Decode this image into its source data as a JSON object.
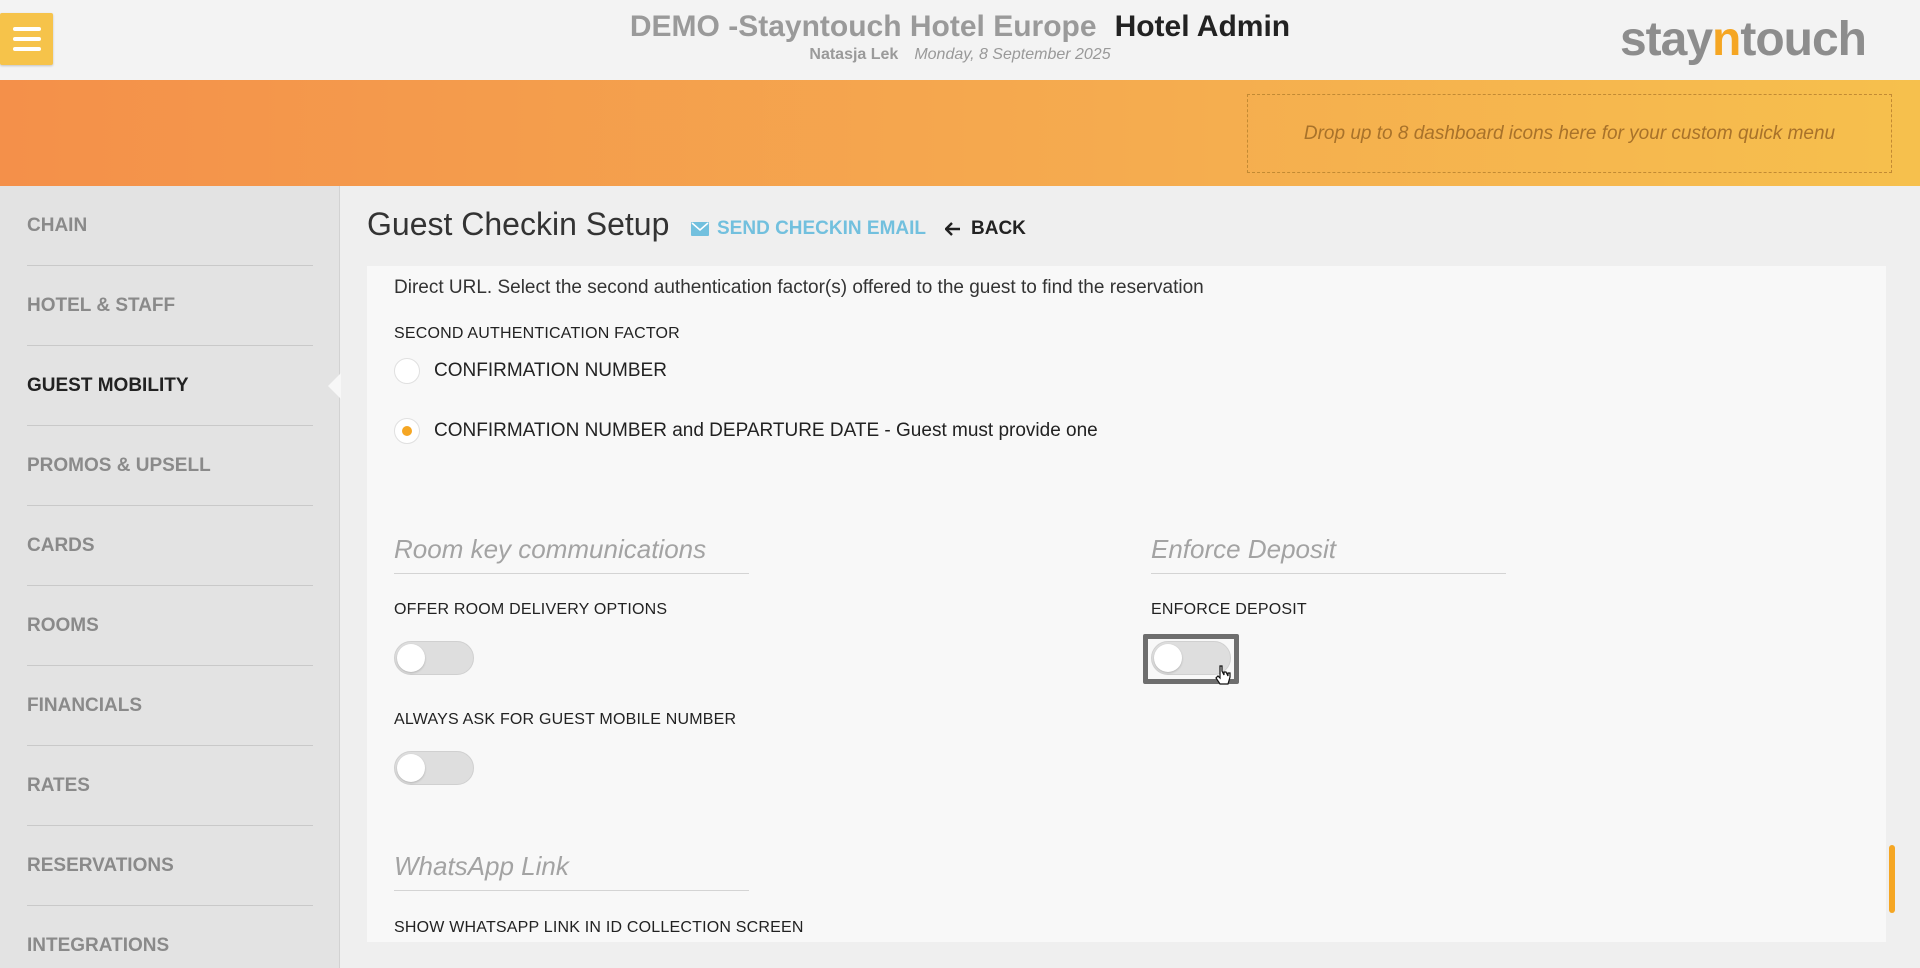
{
  "header": {
    "hotel_name": "DEMO -Stayntouch Hotel Europe",
    "app_name": "Hotel Admin",
    "user": "Natasja Lek",
    "date": "Monday, 8 September 2025",
    "logo_prefix": "stay",
    "logo_n": "n",
    "logo_suffix": "touch"
  },
  "quick_menu": {
    "placeholder": "Drop up to 8 dashboard icons here for your custom quick menu"
  },
  "sidebar": {
    "items": [
      {
        "label": "CHAIN"
      },
      {
        "label": "HOTEL & STAFF"
      },
      {
        "label": "GUEST MOBILITY"
      },
      {
        "label": "PROMOS & UPSELL"
      },
      {
        "label": "CARDS"
      },
      {
        "label": "ROOMS"
      },
      {
        "label": "FINANCIALS"
      },
      {
        "label": "RATES"
      },
      {
        "label": "RESERVATIONS"
      },
      {
        "label": "INTEGRATIONS"
      }
    ],
    "active": "GUEST MOBILITY"
  },
  "page": {
    "title": "Guest Checkin Setup",
    "send_email": "SEND CHECKIN EMAIL",
    "back": "BACK"
  },
  "content": {
    "description": "Direct URL. Select the second authentication factor(s) offered to the guest to find the reservation",
    "auth_label": "SECOND AUTHENTICATION FACTOR",
    "auth_options": [
      {
        "label": "CONFIRMATION NUMBER",
        "selected": false
      },
      {
        "label": "CONFIRMATION NUMBER and DEPARTURE DATE - Guest must provide one",
        "selected": true
      }
    ],
    "room_key_title": "Room key communications",
    "offer_room_delivery_label": "OFFER ROOM DELIVERY OPTIONS",
    "offer_room_delivery_on": false,
    "ask_mobile_label": "ALWAYS ASK FOR GUEST MOBILE NUMBER",
    "ask_mobile_on": false,
    "enforce_deposit_title": "Enforce Deposit",
    "enforce_deposit_label": "ENFORCE DEPOSIT",
    "enforce_deposit_on": false,
    "whatsapp_title": "WhatsApp Link",
    "whatsapp_label": "SHOW WHATSAPP LINK IN ID COLLECTION SCREEN"
  },
  "colors": {
    "accent": "#f5a623",
    "link": "#72c0de",
    "menu_button": "#f6c34a"
  }
}
